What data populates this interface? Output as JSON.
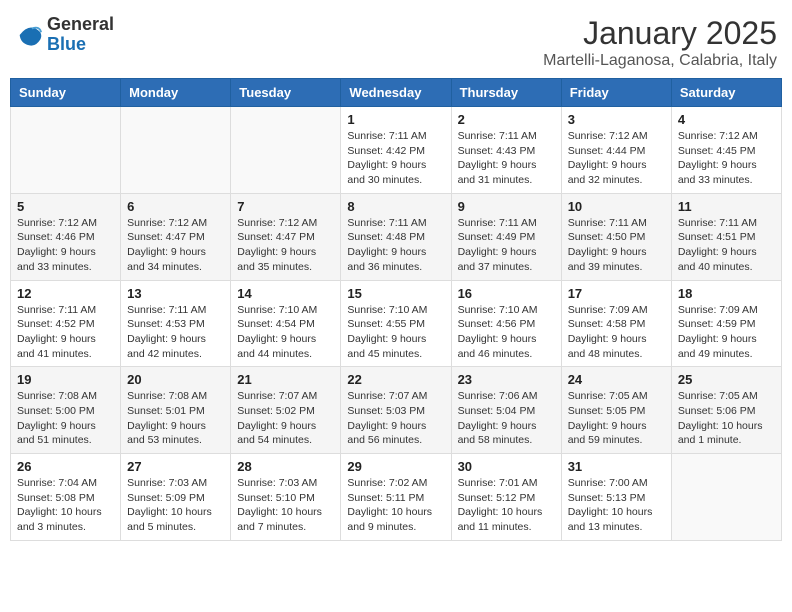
{
  "header": {
    "logo_general": "General",
    "logo_blue": "Blue",
    "month": "January 2025",
    "location": "Martelli-Laganosa, Calabria, Italy"
  },
  "days_of_week": [
    "Sunday",
    "Monday",
    "Tuesday",
    "Wednesday",
    "Thursday",
    "Friday",
    "Saturday"
  ],
  "weeks": [
    [
      {
        "day": "",
        "info": ""
      },
      {
        "day": "",
        "info": ""
      },
      {
        "day": "",
        "info": ""
      },
      {
        "day": "1",
        "info": "Sunrise: 7:11 AM\nSunset: 4:42 PM\nDaylight: 9 hours\nand 30 minutes."
      },
      {
        "day": "2",
        "info": "Sunrise: 7:11 AM\nSunset: 4:43 PM\nDaylight: 9 hours\nand 31 minutes."
      },
      {
        "day": "3",
        "info": "Sunrise: 7:12 AM\nSunset: 4:44 PM\nDaylight: 9 hours\nand 32 minutes."
      },
      {
        "day": "4",
        "info": "Sunrise: 7:12 AM\nSunset: 4:45 PM\nDaylight: 9 hours\nand 33 minutes."
      }
    ],
    [
      {
        "day": "5",
        "info": "Sunrise: 7:12 AM\nSunset: 4:46 PM\nDaylight: 9 hours\nand 33 minutes."
      },
      {
        "day": "6",
        "info": "Sunrise: 7:12 AM\nSunset: 4:47 PM\nDaylight: 9 hours\nand 34 minutes."
      },
      {
        "day": "7",
        "info": "Sunrise: 7:12 AM\nSunset: 4:47 PM\nDaylight: 9 hours\nand 35 minutes."
      },
      {
        "day": "8",
        "info": "Sunrise: 7:11 AM\nSunset: 4:48 PM\nDaylight: 9 hours\nand 36 minutes."
      },
      {
        "day": "9",
        "info": "Sunrise: 7:11 AM\nSunset: 4:49 PM\nDaylight: 9 hours\nand 37 minutes."
      },
      {
        "day": "10",
        "info": "Sunrise: 7:11 AM\nSunset: 4:50 PM\nDaylight: 9 hours\nand 39 minutes."
      },
      {
        "day": "11",
        "info": "Sunrise: 7:11 AM\nSunset: 4:51 PM\nDaylight: 9 hours\nand 40 minutes."
      }
    ],
    [
      {
        "day": "12",
        "info": "Sunrise: 7:11 AM\nSunset: 4:52 PM\nDaylight: 9 hours\nand 41 minutes."
      },
      {
        "day": "13",
        "info": "Sunrise: 7:11 AM\nSunset: 4:53 PM\nDaylight: 9 hours\nand 42 minutes."
      },
      {
        "day": "14",
        "info": "Sunrise: 7:10 AM\nSunset: 4:54 PM\nDaylight: 9 hours\nand 44 minutes."
      },
      {
        "day": "15",
        "info": "Sunrise: 7:10 AM\nSunset: 4:55 PM\nDaylight: 9 hours\nand 45 minutes."
      },
      {
        "day": "16",
        "info": "Sunrise: 7:10 AM\nSunset: 4:56 PM\nDaylight: 9 hours\nand 46 minutes."
      },
      {
        "day": "17",
        "info": "Sunrise: 7:09 AM\nSunset: 4:58 PM\nDaylight: 9 hours\nand 48 minutes."
      },
      {
        "day": "18",
        "info": "Sunrise: 7:09 AM\nSunset: 4:59 PM\nDaylight: 9 hours\nand 49 minutes."
      }
    ],
    [
      {
        "day": "19",
        "info": "Sunrise: 7:08 AM\nSunset: 5:00 PM\nDaylight: 9 hours\nand 51 minutes."
      },
      {
        "day": "20",
        "info": "Sunrise: 7:08 AM\nSunset: 5:01 PM\nDaylight: 9 hours\nand 53 minutes."
      },
      {
        "day": "21",
        "info": "Sunrise: 7:07 AM\nSunset: 5:02 PM\nDaylight: 9 hours\nand 54 minutes."
      },
      {
        "day": "22",
        "info": "Sunrise: 7:07 AM\nSunset: 5:03 PM\nDaylight: 9 hours\nand 56 minutes."
      },
      {
        "day": "23",
        "info": "Sunrise: 7:06 AM\nSunset: 5:04 PM\nDaylight: 9 hours\nand 58 minutes."
      },
      {
        "day": "24",
        "info": "Sunrise: 7:05 AM\nSunset: 5:05 PM\nDaylight: 9 hours\nand 59 minutes."
      },
      {
        "day": "25",
        "info": "Sunrise: 7:05 AM\nSunset: 5:06 PM\nDaylight: 10 hours\nand 1 minute."
      }
    ],
    [
      {
        "day": "26",
        "info": "Sunrise: 7:04 AM\nSunset: 5:08 PM\nDaylight: 10 hours\nand 3 minutes."
      },
      {
        "day": "27",
        "info": "Sunrise: 7:03 AM\nSunset: 5:09 PM\nDaylight: 10 hours\nand 5 minutes."
      },
      {
        "day": "28",
        "info": "Sunrise: 7:03 AM\nSunset: 5:10 PM\nDaylight: 10 hours\nand 7 minutes."
      },
      {
        "day": "29",
        "info": "Sunrise: 7:02 AM\nSunset: 5:11 PM\nDaylight: 10 hours\nand 9 minutes."
      },
      {
        "day": "30",
        "info": "Sunrise: 7:01 AM\nSunset: 5:12 PM\nDaylight: 10 hours\nand 11 minutes."
      },
      {
        "day": "31",
        "info": "Sunrise: 7:00 AM\nSunset: 5:13 PM\nDaylight: 10 hours\nand 13 minutes."
      },
      {
        "day": "",
        "info": ""
      }
    ]
  ]
}
